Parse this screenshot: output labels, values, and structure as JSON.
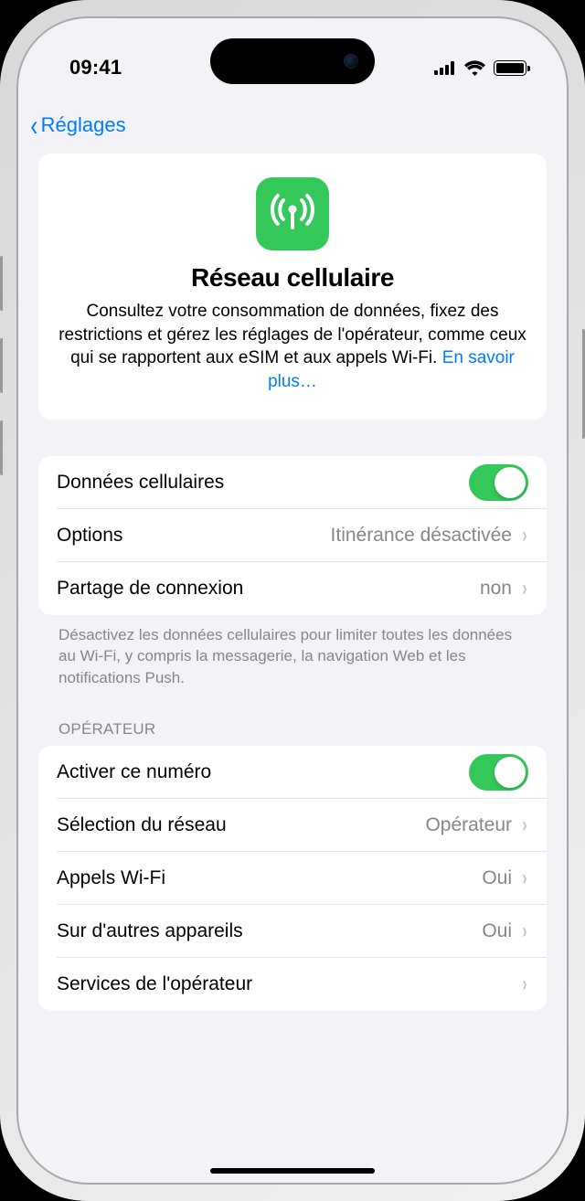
{
  "status": {
    "time": "09:41"
  },
  "nav": {
    "back_label": "Réglages"
  },
  "hero": {
    "title": "Réseau cellulaire",
    "desc": "Consultez votre consommation de données, fixez des restrictions et gérez les réglages de l'opérateur, comme ceux qui se rapportent aux eSIM et aux appels Wi-Fi. ",
    "link_label": "En savoir plus…"
  },
  "section1": {
    "cellular_data_label": "Données cellulaires",
    "options_label": "Options",
    "options_value": "Itinérance désactivée",
    "hotspot_label": "Partage de connexion",
    "hotspot_value": "non",
    "footer": "Désactivez les données cellulaires pour limiter toutes les données au Wi-Fi, y compris la messagerie, la navigation Web et les notifications Push."
  },
  "section2": {
    "header": "OPÉRATEUR",
    "activate_label": "Activer ce numéro",
    "network_label": "Sélection du réseau",
    "network_value": "Opérateur",
    "wifi_calls_label": "Appels Wi-Fi",
    "wifi_calls_value": "Oui",
    "other_devices_label": "Sur d'autres appareils",
    "other_devices_value": "Oui",
    "carrier_services_label": "Services de l'opérateur"
  }
}
